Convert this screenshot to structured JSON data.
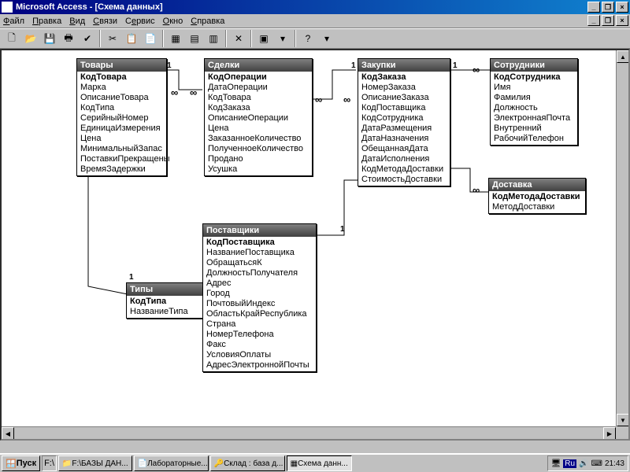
{
  "window": {
    "title": "Microsoft Access - [Схема данных]"
  },
  "menu": {
    "file": "Файл",
    "edit": "Правка",
    "view": "Вид",
    "relations": "Связи",
    "service": "Сервис",
    "window": "Окно",
    "help": "Справка"
  },
  "tables": {
    "tovary": {
      "title": "Товары",
      "fields": [
        "КодТовара",
        "Марка",
        "ОписаниеТовара",
        "КодТипа",
        "СерийныйНомер",
        "ЕдиницаИзмерения",
        "Цена",
        "МинимальныйЗапас",
        "ПоставкиПрекращены",
        "ВремяЗадержки"
      ]
    },
    "sdelki": {
      "title": "Сделки",
      "fields": [
        "КодОперации",
        "ДатаОперации",
        "КодТовара",
        "КодЗаказа",
        "ОписаниеОперации",
        "Цена",
        "ЗаказанноеКоличество",
        "ПолученноеКоличество",
        "Продано",
        "Усушка"
      ]
    },
    "zakupki": {
      "title": "Закупки",
      "fields": [
        "КодЗаказа",
        "НомерЗаказа",
        "ОписаниеЗаказа",
        "КодПоставщика",
        "КодСотрудника",
        "ДатаРазмещения",
        "ДатаНазначения",
        "ОбещаннаяДата",
        "ДатаИсполнения",
        "КодМетодаДоставки",
        "СтоимостьДоставки"
      ]
    },
    "sotrudniki": {
      "title": "Сотрудники",
      "fields": [
        "КодСотрудника",
        "Имя",
        "Фамилия",
        "Должность",
        "ЭлектроннаяПочта",
        "Внутренний",
        "РабочийТелефон"
      ]
    },
    "dostavka": {
      "title": "Доставка",
      "fields": [
        "КодМетодаДоставки",
        "МетодДоставки"
      ]
    },
    "tipy": {
      "title": "Типы",
      "fields": [
        "КодТипа",
        "НазваниеТипа"
      ]
    },
    "postavshiki": {
      "title": "Поставщики",
      "fields": [
        "КодПоставщика",
        "НазваниеПоставщика",
        "ОбращатьсяК",
        "ДолжностьПолучателя",
        "Адрес",
        "Город",
        "ПочтовыйИндекс",
        "ОбластьКрайРеспублика",
        "Страна",
        "НомерТелефона",
        "Факс",
        "УсловияОплаты",
        "АдресЭлектроннойПочты"
      ]
    }
  },
  "rel": {
    "one": "1",
    "inf": "∞"
  },
  "taskbar": {
    "start": "Пуск",
    "ql": "F:\\",
    "t1": "F:\\БАЗЫ ДАН...",
    "t2": "Лабораторные...",
    "t3": "Склад : база д...",
    "t4": "Схема данн...",
    "lang": "Ru",
    "clock": "21:43"
  }
}
